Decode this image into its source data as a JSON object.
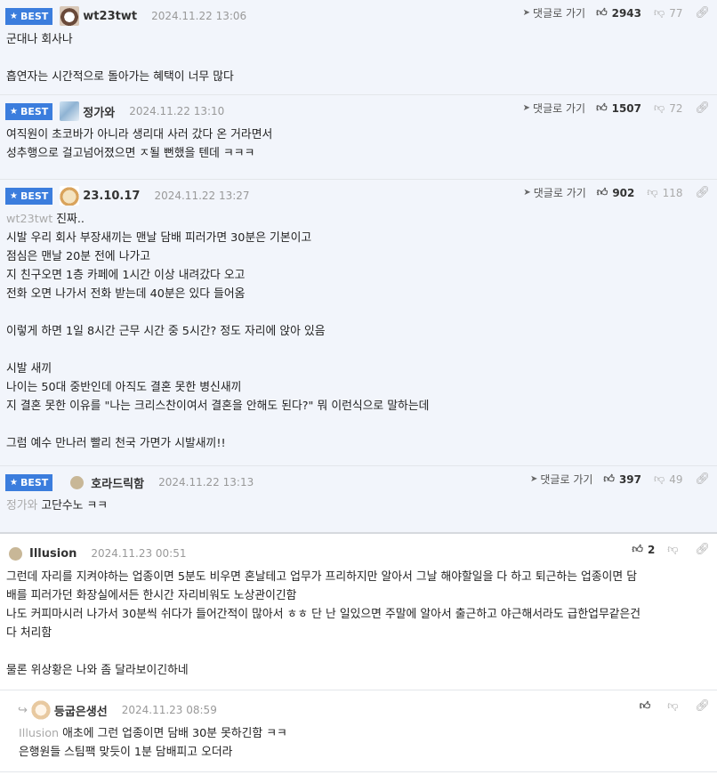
{
  "ui": {
    "best_label": "BEST",
    "reply_link": "댓글로 가기"
  },
  "comments": [
    {
      "best": true,
      "author": "wt23twt",
      "avatar": "dog-avatar",
      "date": "2024.11.22 13:06",
      "up": "2943",
      "down": "77",
      "lines": [
        "군대나 회사나",
        "",
        "흡연자는 시간적으로 돌아가는 혜택이 너무 많다"
      ]
    },
    {
      "best": true,
      "author": "정가와",
      "avatar": "bear-avatar",
      "date": "2024.11.22 13:10",
      "up": "1507",
      "down": "72",
      "lines": [
        "여직원이 초코바가 아니라 생리대 사러 갔다 온 거라면서",
        "성추행으로 걸고넘어졌으면 ㅈ될 뻔했을 텐데 ㅋㅋㅋ"
      ]
    },
    {
      "best": true,
      "author": "23.10.17",
      "avatar": "dog-avatar",
      "date": "2024.11.22 13:27",
      "up": "902",
      "down": "118",
      "ref": "wt23twt",
      "lines": [
        "진짜..",
        "시발 우리 회사 부장새끼는 맨날 담배 피러가면 30분은 기본이고",
        "점심은 맨날 20분 전에 나가고",
        "지 친구오면 1층 카페에 1시간 이상 내려갔다 오고",
        "전화 오면 나가서 전화 받는데 40분은 있다 들어옴",
        "",
        "이렇게 하면 1일 8시간 근무 시간 중 5시간? 정도 자리에 앉아 있음",
        "",
        "시발 새끼",
        "나이는 50대 중반인데 아직도 결혼 못한 병신새끼",
        "지 결혼 못한 이유를 \"나는 크리스찬이여서 결혼을 안해도 된다?\" 뭐 이런식으로 말하는데",
        "",
        "그럼 예수 만나러 빨리 천국 가면가 시발새끼!!"
      ]
    },
    {
      "best": true,
      "author": "호라드릭함",
      "avatar": "default-avatar",
      "date": "2024.11.22 13:13",
      "up": "397",
      "down": "49",
      "ref": "정가와",
      "lines": [
        "고단수노 ㅋㅋ"
      ]
    },
    {
      "best": false,
      "author": "Illusion",
      "avatar": "default-avatar",
      "date": "2024.11.23 00:51",
      "up": "2",
      "down": "",
      "lines": [
        "그런데 자리를 지켜야하는 업종이면 5분도 비우면 혼날테고 업무가 프리하지만 알아서 그날 해야할일을 다 하고 퇴근하는 업종이면 담",
        "배를 피러가던 화장실에서든 한시간 자리비워도 노상관이긴함",
        "나도 커피마시러 나가서 30분씩 쉬다가 들어간적이 많아서 ㅎㅎ 단 난 일있으면 주말에 알아서 출근하고 야근해서라도 급한업무같은건",
        "다 처리함",
        "",
        "물론 위상황은 나와 좀 달라보이긴하네"
      ]
    },
    {
      "best": false,
      "author": "등굽은생선",
      "avatar": "puppy-avatar",
      "date": "2024.11.23 08:59",
      "up": "",
      "down": "",
      "ref": "Illusion",
      "lines": [
        "애초에 그런 업종이면 담배 30분 못하긴함 ㅋㅋ",
        "은행원들 스팀팩 맞듯이 1분 담배피고 오더라"
      ]
    }
  ]
}
